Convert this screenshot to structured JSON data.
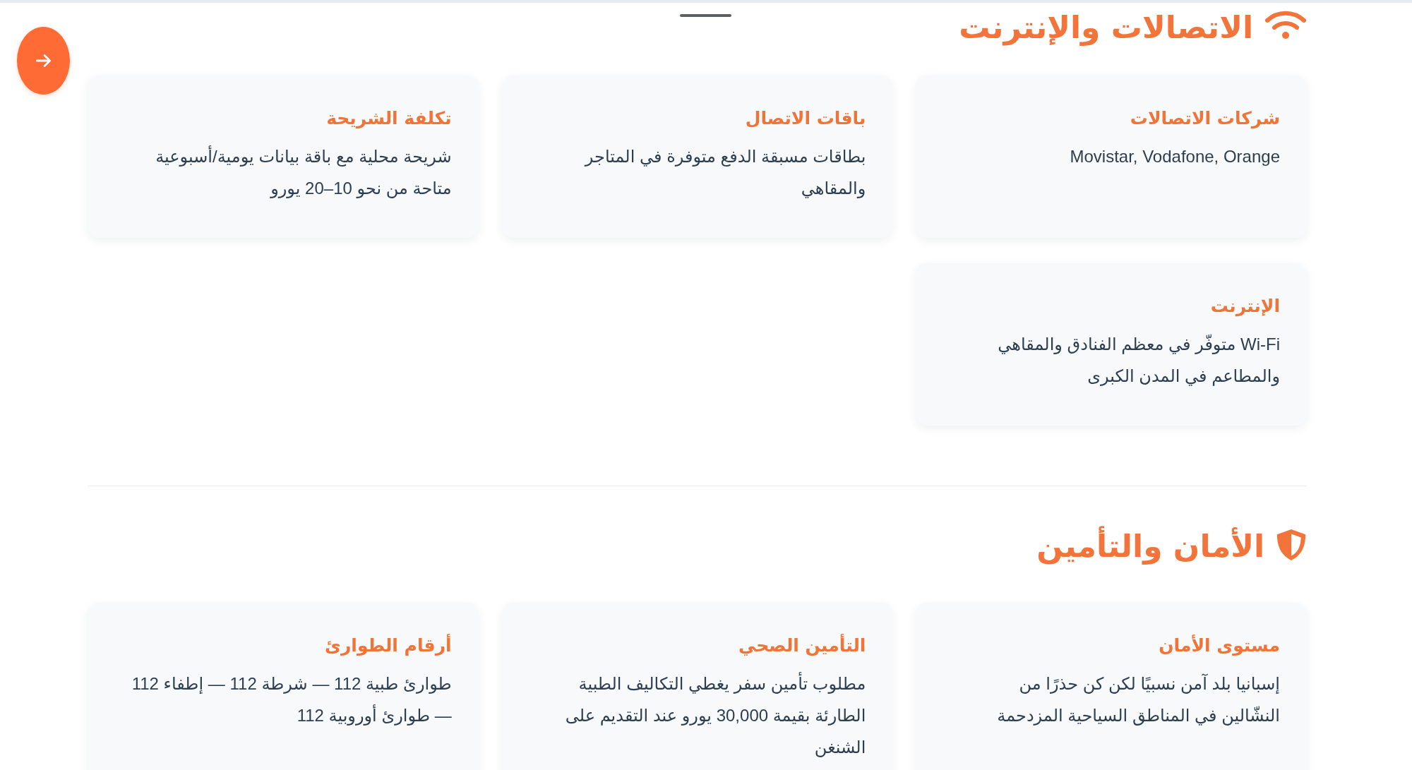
{
  "sections": [
    {
      "kind": "network",
      "title": "الاتصالات والإنترنت",
      "cards": [
        {
          "title": "شركات الاتصالات",
          "text": "Movistar, Vodafone, Orange"
        },
        {
          "title": "باقات الاتصال",
          "text": "بطاقات مسبقة الدفع متوفرة في المتاجر والمقاهي"
        },
        {
          "title": "تكلفة الشريحة",
          "text": "شريحة محلية مع باقة بيانات يومية/أسبوعية متاحة من نحو 10–20 يورو"
        },
        {
          "title": "الإنترنت",
          "text": "Wi-Fi متوفّر في معظم الفنادق والمقاهي والمطاعم في المدن الكبرى"
        }
      ]
    },
    {
      "kind": "security",
      "title": "الأمان والتأمين",
      "cards": [
        {
          "title": "مستوى الأمان",
          "text": "إسبانيا بلد آمن نسبيًا لكن كن حذرًا من النشّالين في المناطق السياحية المزدحمة"
        },
        {
          "title": "التأمين الصحي",
          "text": "مطلوب تأمين سفر يغطي التكاليف الطبية الطارئة بقيمة 30,000 يورو عند التقديم على الشنغن"
        },
        {
          "title": "أرقام الطوارئ",
          "text": "طوارئ طبية 112 — شرطة 112 — إطفاء 112 — طوارئ أوروبية 112"
        }
      ]
    }
  ]
}
